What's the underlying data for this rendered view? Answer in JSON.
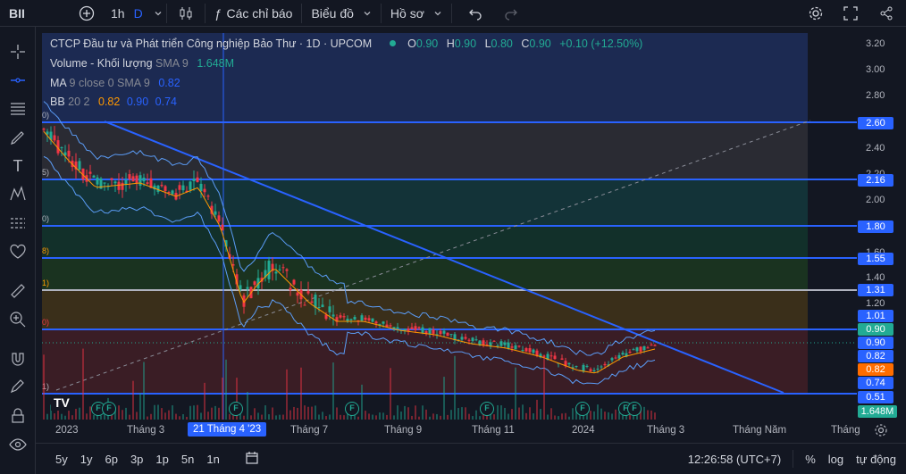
{
  "topbar": {
    "symbol": "BII",
    "add_icon": "plus-circle-icon",
    "interval": "1h",
    "interval_alt": "D",
    "indicators_label": "Các chỉ báo",
    "chart_label": "Biểu đồ",
    "profile_label": "Hồ sơ"
  },
  "legend": {
    "title": "CTCP Đầu tư và Phát triển Công nghiệp Bảo Thư · 1D · UPCOM",
    "o_label": "O",
    "o_val": "0.90",
    "h_label": "H",
    "h_val": "0.90",
    "l_label": "L",
    "l_val": "0.80",
    "c_label": "C",
    "c_val": "0.90",
    "change": "+0.10 (+12.50%)",
    "volume_label": "Volume - Khối lượng",
    "volume_sma": "SMA 9",
    "volume_val": "1.648M",
    "ma_label": "MA",
    "ma_params": "9 close 0 SMA 9",
    "ma_val": "0.82",
    "bb_label": "BB",
    "bb_params": "20 2",
    "bb_v1": "0.82",
    "bb_v2": "0.90",
    "bb_v3": "0.74"
  },
  "price_scale": {
    "ticks": [
      "3.20",
      "3.00",
      "2.80",
      "2.40",
      "2.20",
      "2.00",
      "1.60",
      "1.40",
      "1.20"
    ],
    "labels": [
      "2.60",
      "2.16",
      "1.80",
      "1.55",
      "1.31",
      "1.01",
      "0.90",
      "0.90",
      "0.82",
      "0.82",
      "0.74",
      "0.51",
      "1.648M"
    ]
  },
  "time_scale": {
    "labels": [
      "2023",
      "Tháng 3",
      "21 Tháng 4 '23",
      "Tháng 7",
      "Tháng 9",
      "Tháng 11",
      "2024",
      "Tháng 3",
      "Tháng Năm",
      "Tháng"
    ]
  },
  "bottombar": {
    "ranges": [
      "5y",
      "1y",
      "6p",
      "3p",
      "1p",
      "5n",
      "1n"
    ],
    "time": "12:26:58 (UTC+7)",
    "percent": "%",
    "log": "log",
    "auto": "tự động"
  },
  "fib_edge_labels": [
    "0)",
    "5)",
    "0)",
    "8)",
    "1)",
    "0)",
    "1)"
  ],
  "events": [
    "F",
    "F",
    "F",
    "F",
    "F",
    "F",
    "F",
    "F"
  ],
  "colors": {
    "bg": "#131722",
    "up": "#22ab94",
    "down": "#f23645",
    "line": "#2962ff",
    "ma": "#ff9800",
    "bb": "#5b9cf6"
  }
}
